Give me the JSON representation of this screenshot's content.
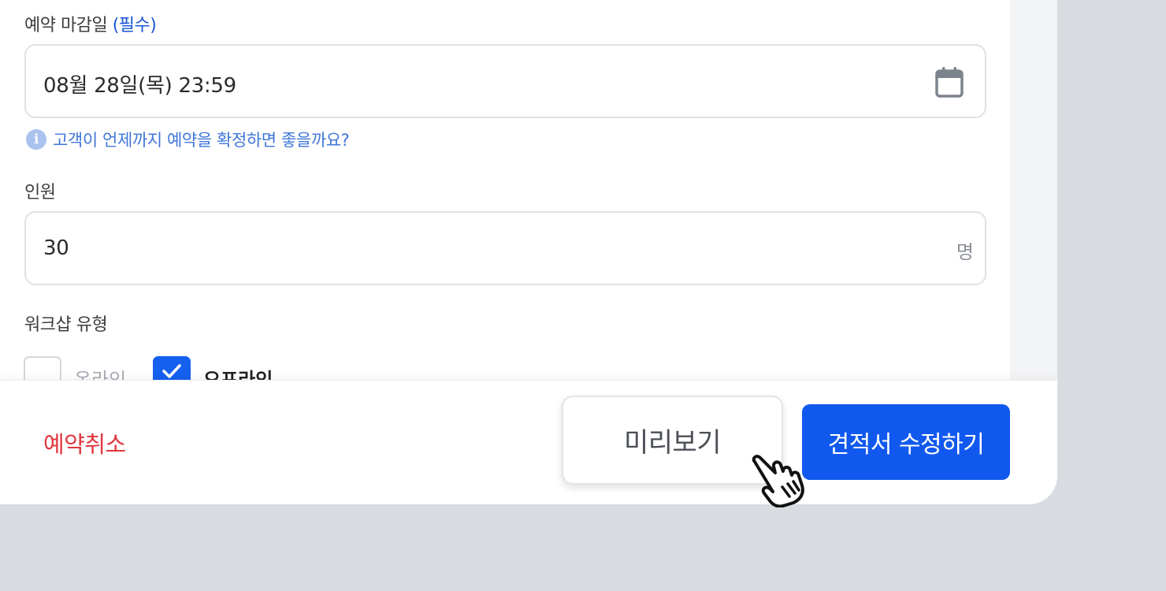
{
  "deadline": {
    "label": "예약 마감일",
    "required_tag": "(필수)",
    "value": "08월 28일(목) 23:59",
    "icon": "calendar-icon",
    "hint": "고객이 언제까지 예약을 확정하면 좋을까요?",
    "hint_icon": "info-icon",
    "hint_icon_glyph": "i"
  },
  "headcount": {
    "label": "인원",
    "value": "30",
    "unit": "명"
  },
  "workshop_type": {
    "label": "워크샵 유형",
    "options": [
      {
        "label": "온라인",
        "checked": false
      },
      {
        "label": "오프라인",
        "checked": true
      }
    ]
  },
  "footer": {
    "cancel_label": "예약취소",
    "preview_label": "미리보기",
    "submit_label": "견적서 수정하기"
  },
  "colors": {
    "accent": "#1159ee",
    "danger": "#e0373d",
    "hint": "#3f76d8",
    "backdrop": "#d8dbe0"
  }
}
